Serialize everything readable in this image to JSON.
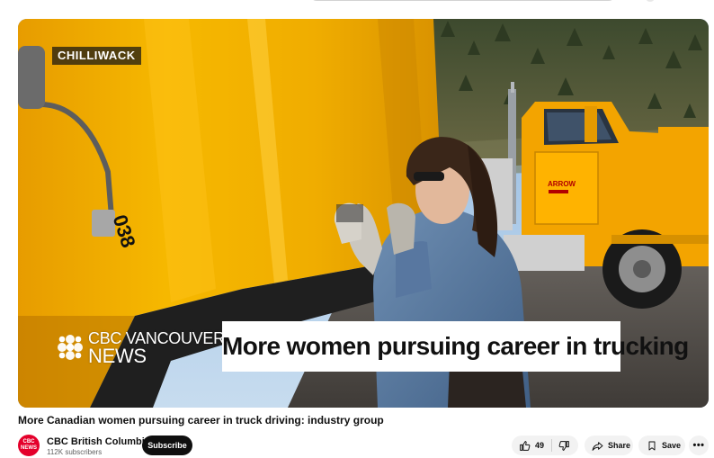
{
  "video": {
    "location_tag": "CHILLIWACK",
    "brand_line1": "CBC VANCOUVER",
    "brand_line2": "NEWS",
    "lower_third": "More women pursuing career in trucking",
    "truck_door_text": "ARROW",
    "truck_number": "038"
  },
  "title": "More Canadian women pursuing career in truck driving: industry group",
  "channel": {
    "avatar_text_1": "CBC",
    "avatar_text_2": "NEWS",
    "name": "CBC British Columbia",
    "subscribers": "112K subscribers",
    "subscribe_label": "Subscribe"
  },
  "actions": {
    "like_count": "49",
    "share_label": "Share",
    "save_label": "Save",
    "more_label": "•••"
  },
  "colors": {
    "cbc_red": "#e4002b",
    "truck_yellow": "#f2b600",
    "pill_bg": "#f2f2f2"
  },
  "icons": [
    "thumbs-up-icon",
    "thumbs-down-icon",
    "share-arrow-icon",
    "bookmark-icon",
    "more-horizontal-icon",
    "cbc-gem-logo"
  ]
}
